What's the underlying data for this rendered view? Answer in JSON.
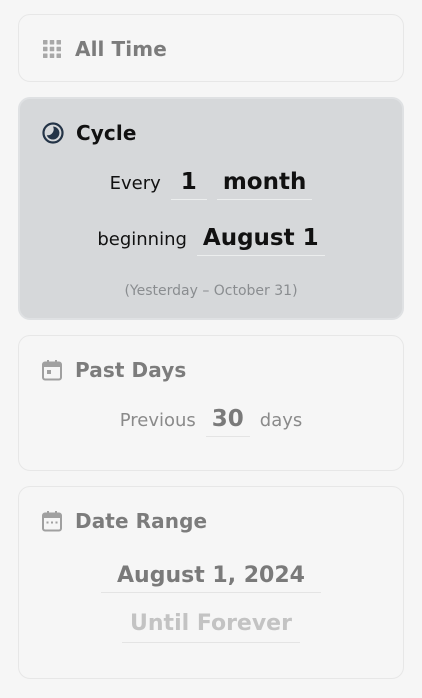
{
  "modes": {
    "all_time": {
      "title": "All Time",
      "icon": "grid-icon"
    },
    "cycle": {
      "title": "Cycle",
      "icon": "moon-phase-icon",
      "every_label": "Every",
      "count_value": "1",
      "unit_value": "month",
      "beginning_label": "beginning",
      "start_value": "August 1",
      "note": "(Yesterday – October 31)",
      "selected": true
    },
    "past_days": {
      "title": "Past Days",
      "icon": "calendar-day-icon",
      "previous_label": "Previous",
      "days_value": "30",
      "days_label": "days"
    },
    "date_range": {
      "title": "Date Range",
      "icon": "calendar-range-icon",
      "start_value": "August 1, 2024",
      "end_value": "Until Forever"
    }
  },
  "colors": {
    "background": "#f6f6f6",
    "selected_card": "#d6d8da",
    "text_primary": "#111111",
    "text_muted": "#7c7c7c"
  }
}
